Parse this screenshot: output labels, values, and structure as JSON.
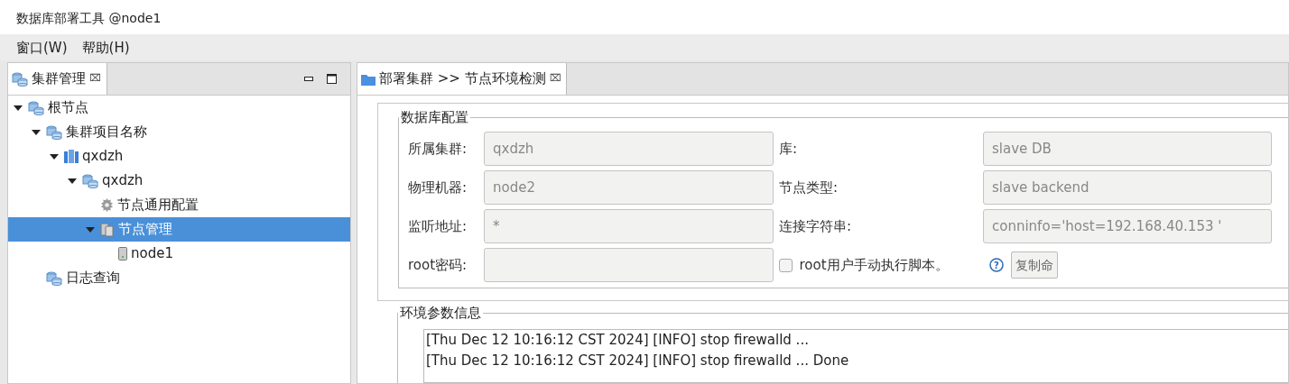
{
  "window": {
    "title": "数据库部署工具 @node1"
  },
  "menu": [
    "窗口(W)",
    "帮助(H)"
  ],
  "left_panel": {
    "tab": {
      "label": "集群管理",
      "close": "⌧"
    },
    "tree": [
      {
        "label": "根节点",
        "kind": "db",
        "expanded": true,
        "selected": false,
        "children": [
          {
            "label": "集群项目名称",
            "kind": "db",
            "expanded": true,
            "selected": false,
            "children": [
              {
                "label": "qxdzh",
                "kind": "cluster",
                "expanded": true,
                "selected": false,
                "children": [
                  {
                    "label": "qxdzh",
                    "kind": "db",
                    "expanded": true,
                    "selected": false,
                    "children": [
                      {
                        "label": "节点通用配置",
                        "kind": "gear",
                        "selected": false
                      },
                      {
                        "label": "节点管理",
                        "kind": "servers",
                        "expanded": true,
                        "selected": true,
                        "children": [
                          {
                            "label": "node1",
                            "kind": "server",
                            "selected": false
                          }
                        ]
                      }
                    ]
                  }
                ]
              }
            ]
          },
          {
            "label": "日志查询",
            "kind": "db",
            "selected": false
          }
        ]
      }
    ]
  },
  "right_panel": {
    "tab": {
      "label": "部署集群 >> 节点环境检测",
      "close": "⌧"
    },
    "db_config": {
      "title": "数据库配置",
      "fields": [
        {
          "label": "所属集群:",
          "value": "qxdzh"
        },
        {
          "label": "库:",
          "value": "slave DB"
        },
        {
          "label": "物理机器:",
          "value": "node2"
        },
        {
          "label": "节点类型:",
          "value": "slave backend"
        },
        {
          "label": "监听地址:",
          "value": "*"
        },
        {
          "label": "连接字符串:",
          "value": "conninfo='host=192.168.40.153 '"
        },
        {
          "label": "root密码:"
        }
      ],
      "help": "?",
      "manual_checkbox": {
        "label": "root用户手动执行脚本。",
        "checked": false
      },
      "copy_button": "复制命"
    },
    "env_info": {
      "title": "环境参数信息",
      "log": [
        "[Thu Dec 12 10:16:12 CST 2024] [INFO] stop firewalld ...",
        "[Thu Dec 12 10:16:12 CST 2024] [INFO] stop firewalld ... Done"
      ]
    }
  }
}
